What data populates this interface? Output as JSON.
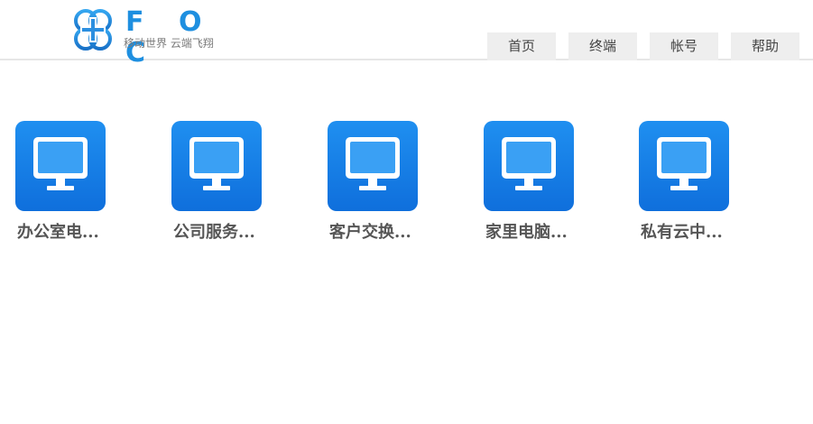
{
  "header": {
    "logo_text": "F O C",
    "slogan": "移动世界 云端飞翔",
    "brand_color": "#1e8fe0"
  },
  "nav": {
    "items": [
      {
        "label": "首页"
      },
      {
        "label": "终端"
      },
      {
        "label": "帐号"
      },
      {
        "label": "帮助"
      }
    ]
  },
  "terminals": {
    "icon": "monitor-icon",
    "tile_color": "#1a86ec",
    "items": [
      {
        "label": "办公室电..."
      },
      {
        "label": "公司服务..."
      },
      {
        "label": "客户交换..."
      },
      {
        "label": "家里电脑..."
      },
      {
        "label": "私有云中..."
      }
    ]
  }
}
